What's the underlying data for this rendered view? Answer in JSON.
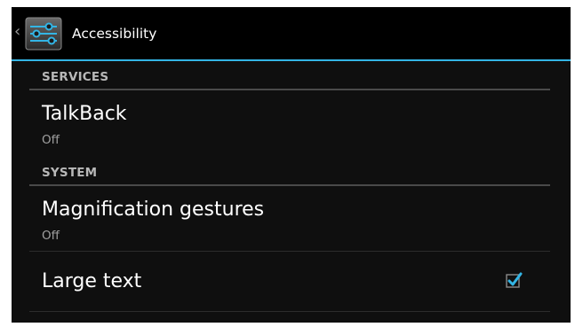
{
  "actionbar": {
    "up_icon": "chevron-left-icon",
    "app_icon": "settings-sliders-icon",
    "title": "Accessibility"
  },
  "sections": [
    {
      "header": "SERVICES",
      "items": [
        {
          "title": "TalkBack",
          "summary": "Off"
        }
      ]
    },
    {
      "header": "SYSTEM",
      "items": [
        {
          "title": "Magnification gestures",
          "summary": "Off"
        },
        {
          "title": "Large text",
          "checked": true
        }
      ]
    }
  ],
  "colors": {
    "accent": "#33b5e5",
    "background": "#0f0f0f",
    "actionbar": "#000000",
    "text_primary": "#ffffff",
    "text_secondary": "#a0a0a0"
  }
}
